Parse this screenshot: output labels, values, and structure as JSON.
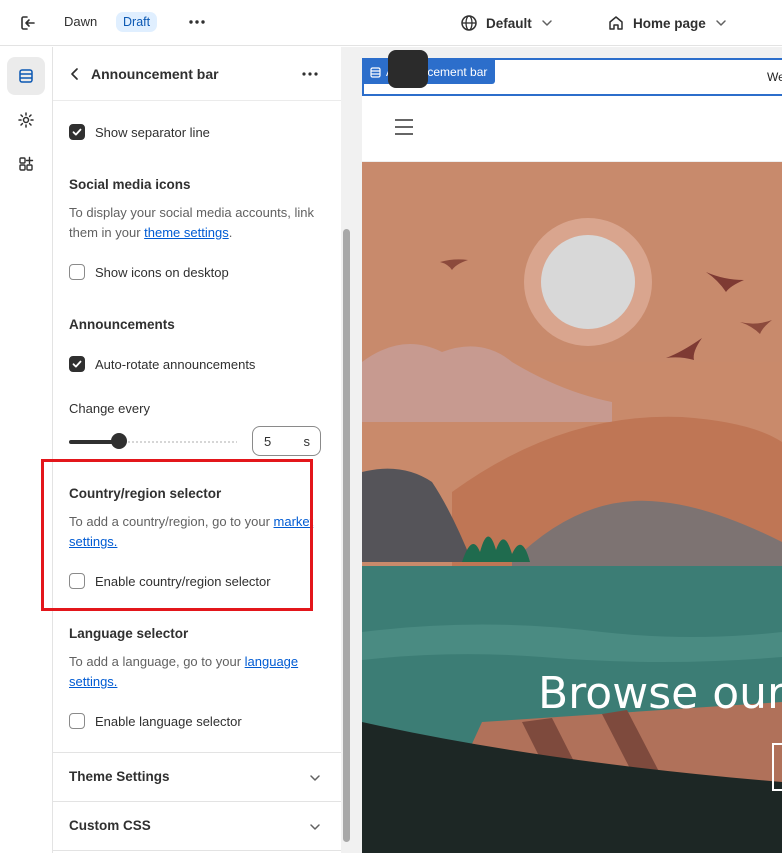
{
  "topbar": {
    "theme_name": "Dawn",
    "status_badge": "Draft",
    "language_label": "Default",
    "page_label": "Home page"
  },
  "panel": {
    "title": "Announcement bar",
    "separator": {
      "label": "Show separator line",
      "checked": true
    },
    "social": {
      "heading": "Social media icons",
      "desc_prefix": "To display your social media accounts, link them in your ",
      "link": "theme settings",
      "desc_suffix": ".",
      "checkbox": {
        "label": "Show icons on desktop",
        "checked": false
      }
    },
    "announcements": {
      "heading": "Announcements",
      "checkbox": {
        "label": "Auto-rotate announcements",
        "checked": true
      },
      "change_every_label": "Change every",
      "change_every_value": "5",
      "change_every_unit": "s",
      "slider_fraction": 0.3
    },
    "country": {
      "heading": "Country/region selector",
      "desc_prefix": "To add a country/region, go to your ",
      "link": "market settings.",
      "checkbox": {
        "label": "Enable country/region selector",
        "checked": false
      }
    },
    "language": {
      "heading": "Language selector",
      "desc_prefix": "To add a language, go to your ",
      "link": "language settings.",
      "checkbox": {
        "label": "Enable language selector",
        "checked": false
      }
    },
    "sections": [
      "Theme Settings",
      "Custom CSS"
    ]
  },
  "preview": {
    "announcement_tag": "Announcement bar",
    "announcement_text": "We",
    "hero_heading": "Browse our"
  },
  "colors": {
    "accent": "#005bd3",
    "highlight": "#e3161b",
    "selection": "#2c6ecb"
  }
}
